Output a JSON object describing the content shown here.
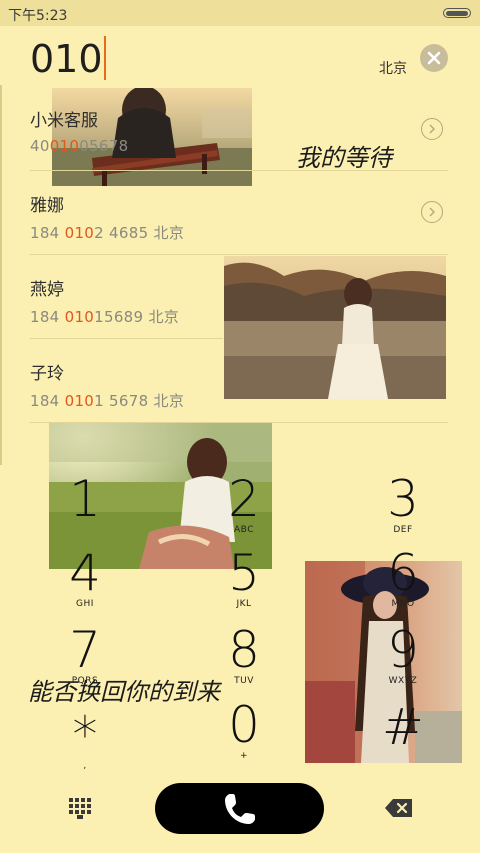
{
  "status_bar": {
    "time": "下午5:23"
  },
  "dialer": {
    "input": "010",
    "location": "北京"
  },
  "contacts": [
    {
      "name": "小米客服",
      "number_pre": "40",
      "number_match": "010",
      "number_post": "05678",
      "city": ""
    },
    {
      "name": "雅娜",
      "number_pre": "184 ",
      "number_match": "010",
      "number_post": "2 4685",
      "city": "北京"
    },
    {
      "name": "燕婷",
      "number_pre": "184 ",
      "number_match": "010",
      "number_post": "15689",
      "city": "北京"
    },
    {
      "name": "子玲",
      "number_pre": "184 ",
      "number_match": "010",
      "number_post": "1 5678",
      "city": "北京"
    }
  ],
  "decor": {
    "text_1": "我的等待",
    "text_2": "能否换回你的到来"
  },
  "keypad": [
    {
      "digit": "1",
      "letters": ""
    },
    {
      "digit": "2",
      "letters": "ABC"
    },
    {
      "digit": "3",
      "letters": "DEF"
    },
    {
      "digit": "4",
      "letters": "GHI"
    },
    {
      "digit": "5",
      "letters": "JKL"
    },
    {
      "digit": "6",
      "letters": "MNO"
    },
    {
      "digit": "7",
      "letters": "PQRS"
    },
    {
      "digit": "8",
      "letters": "TUV"
    },
    {
      "digit": "9",
      "letters": "WXYZ"
    },
    {
      "digit": "*",
      "letters": ","
    },
    {
      "digit": "0",
      "letters": "+"
    },
    {
      "digit": "#",
      "letters": ""
    }
  ],
  "icons": {
    "battery": "battery-icon",
    "clear": "clear-icon",
    "chevron": "chevron-right-icon",
    "call": "phone-icon",
    "keypad": "keypad-icon",
    "backspace": "backspace-icon"
  },
  "colors": {
    "background": "#fbefb1",
    "highlight": "#e2571e",
    "call_button": "#000000"
  }
}
